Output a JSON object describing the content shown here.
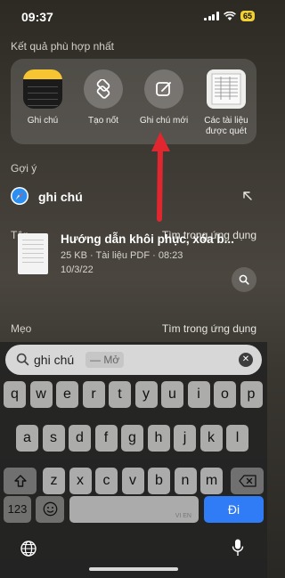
{
  "status_bar": {
    "time": "09:37",
    "battery": "65"
  },
  "best_match": {
    "title": "Kết quả phù hợp nhất",
    "apps": [
      {
        "label": "Ghi chú",
        "icon": "notes-app-icon"
      },
      {
        "label": "Tạo nốt",
        "icon": "stack-icon"
      },
      {
        "label": "Ghi chú mới",
        "icon": "compose-note-icon"
      },
      {
        "label": "Các tài liệu được quét",
        "icon": "scanned-document-icon"
      }
    ]
  },
  "suggestions": {
    "title": "Gợi ý",
    "item": "ghi chú"
  },
  "files": {
    "title": "Tệp",
    "search_in_app": "Tìm trong ứng dụng",
    "item": {
      "name": "Hướng dẫn khôi phục, xóa b...",
      "meta": "25 KB · Tài liệu PDF · 08:23",
      "date": "10/3/22"
    }
  },
  "tips": {
    "title": "Mẹo",
    "search_in_app": "Tìm trong ứng dụng"
  },
  "search": {
    "query": "ghi chú",
    "suggestion": "— Mở"
  },
  "keyboard": {
    "row1": [
      "q",
      "w",
      "e",
      "r",
      "t",
      "y",
      "u",
      "i",
      "o",
      "p"
    ],
    "row2": [
      "a",
      "s",
      "d",
      "f",
      "g",
      "h",
      "j",
      "k",
      "l"
    ],
    "row3": [
      "z",
      "x",
      "c",
      "v",
      "b",
      "n",
      "m"
    ],
    "numbers": "123",
    "space_label": "VI EN",
    "enter": "Đi"
  },
  "colors": {
    "accent_blue": "#2f7cf6",
    "arrow_red": "#e0262f",
    "battery_yellow": "#f2cf33"
  }
}
